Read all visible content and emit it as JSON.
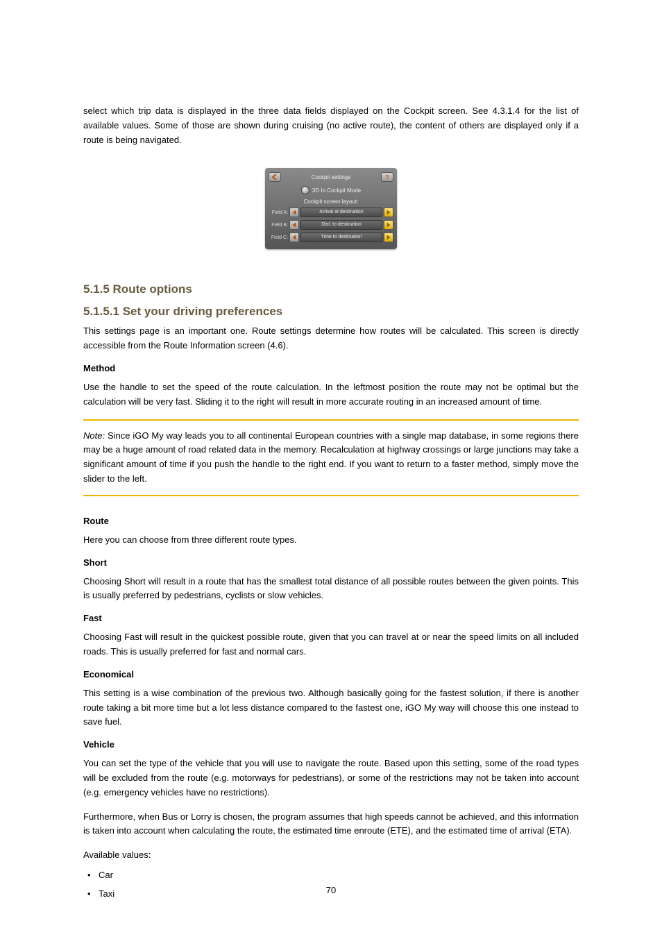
{
  "intro": "select which trip data is displayed in the three data fields displayed on the Cockpit screen. See 4.3.1.4 for the list of available values. Some of those are shown during cruising (no active route), the content of others are displayed only if a route is being navigated.",
  "screenshot": {
    "title": "Cockpit settings",
    "toggle": "3D In Cockpit Mode",
    "layout_label": "Cockpit screen layout:",
    "fields": [
      {
        "label": "Field A:",
        "value": "Arrival at destination"
      },
      {
        "label": "Field B:",
        "value": "Dist. to destination"
      },
      {
        "label": "Field C:",
        "value": "Time to destination"
      }
    ]
  },
  "heading_main": "5.1.5 Route options",
  "heading_sub": "5.1.5.1 Set your driving preferences",
  "sub_text": "This settings page is an important one. Route settings determine how routes will be calculated. This screen is directly accessible from the Route Information screen (4.6).",
  "sec_method_title": "Method",
  "sec_method_text": "Use the handle to set the speed of the route calculation. In the leftmost position the route may not be optimal but the calculation will be very fast. Sliding it to the right will result in more accurate routing in an increased amount of time.",
  "note": {
    "label": "Note:",
    "text": "Since iGO My way leads you to all continental European countries with a single map database, in some regions there may be a huge amount of road related data in the memory. Recalculation at highway crossings or large junctions may take a significant amount of time if you push the handle to the right end. If you want to return to a faster method, simply move the slider to the left."
  },
  "sec_route_title": "Route",
  "sec_route_intro": "Here you can choose from three different route types.",
  "sec_short_title": "Short",
  "sec_short_text": "Choosing Short will result in a route that has the smallest total distance of all possible routes between the given points. This is usually preferred by pedestrians, cyclists or slow vehicles.",
  "sec_fast_title": "Fast",
  "sec_fast_text": "Choosing Fast will result in the quickest possible route, given that you can travel at or near the speed limits on all included roads. This is usually preferred for fast and normal cars.",
  "sec_econ_title": "Economical",
  "sec_econ_text": "This setting is a wise combination of the previous two. Although basically going for the fastest solution, if there is another route taking a bit more time but a lot less distance compared to the fastest one, iGO My way will choose this one instead to save fuel.",
  "sec_vehicle_title": "Vehicle",
  "sec_vehicle_intro": "You can set the type of the vehicle that you will use to navigate the route. Based upon this setting, some of the road types will be excluded from the route (e.g. motorways for pedestrians), or some of the restrictions may not be taken into account (e.g. emergency vehicles have no restrictions).",
  "sec_vehicle_extra": "Furthermore, when Bus or Lorry is chosen, the program assumes that high speeds cannot be achieved, and this information is taken into account when calculating the route, the estimated time enroute (ETE), and the estimated time of arrival (ETA).",
  "sec_vehicle_list_intro": "Available values:",
  "vehicle_items": [
    "Car",
    "Taxi"
  ],
  "page_number": "70"
}
